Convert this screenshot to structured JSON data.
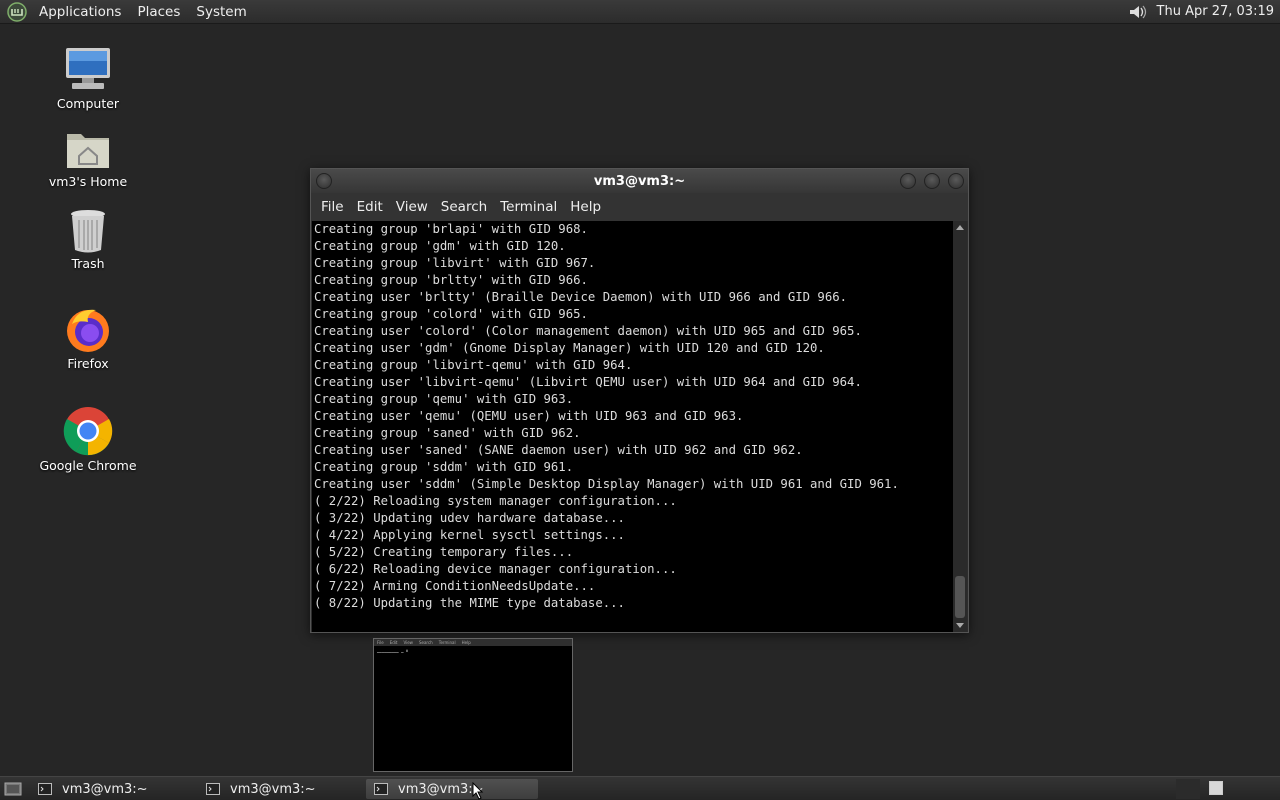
{
  "top_panel": {
    "menus": [
      "Applications",
      "Places",
      "System"
    ],
    "clock": "Thu Apr 27, 03:19"
  },
  "desktop": {
    "icons": [
      {
        "label": "Computer",
        "icon": "computer-icon"
      },
      {
        "label": "vm3's Home",
        "icon": "home-folder-icon"
      },
      {
        "label": "Trash",
        "icon": "trash-icon"
      },
      {
        "label": "Firefox",
        "icon": "firefox-icon"
      },
      {
        "label": "Google Chrome",
        "icon": "chrome-icon"
      }
    ]
  },
  "terminal": {
    "title": "vm3@vm3:~",
    "menu": [
      "File",
      "Edit",
      "View",
      "Search",
      "Terminal",
      "Help"
    ],
    "lines": [
      "Creating group 'brlapi' with GID 968.",
      "Creating group 'gdm' with GID 120.",
      "Creating group 'libvirt' with GID 967.",
      "Creating group 'brltty' with GID 966.",
      "Creating user 'brltty' (Braille Device Daemon) with UID 966 and GID 966.",
      "Creating group 'colord' with GID 965.",
      "Creating user 'colord' (Color management daemon) with UID 965 and GID 965.",
      "Creating user 'gdm' (Gnome Display Manager) with UID 120 and GID 120.",
      "Creating group 'libvirt-qemu' with GID 964.",
      "Creating user 'libvirt-qemu' (Libvirt QEMU user) with UID 964 and GID 964.",
      "Creating group 'qemu' with GID 963.",
      "Creating user 'qemu' (QEMU user) with UID 963 and GID 963.",
      "Creating group 'saned' with GID 962.",
      "Creating user 'saned' (SANE daemon user) with UID 962 and GID 962.",
      "Creating group 'sddm' with GID 961.",
      "Creating user 'sddm' (Simple Desktop Display Manager) with UID 961 and GID 961.",
      "( 2/22) Reloading system manager configuration...",
      "( 3/22) Updating udev hardware database...",
      "( 4/22) Applying kernel sysctl settings...",
      "( 5/22) Creating temporary files...",
      "( 6/22) Reloading device manager configuration...",
      "( 7/22) Arming ConditionNeedsUpdate...",
      "( 8/22) Updating the MIME type database..."
    ]
  },
  "taskbar": {
    "tasks": [
      "vm3@vm3:~",
      "vm3@vm3:~",
      "vm3@vm3:~"
    ]
  }
}
